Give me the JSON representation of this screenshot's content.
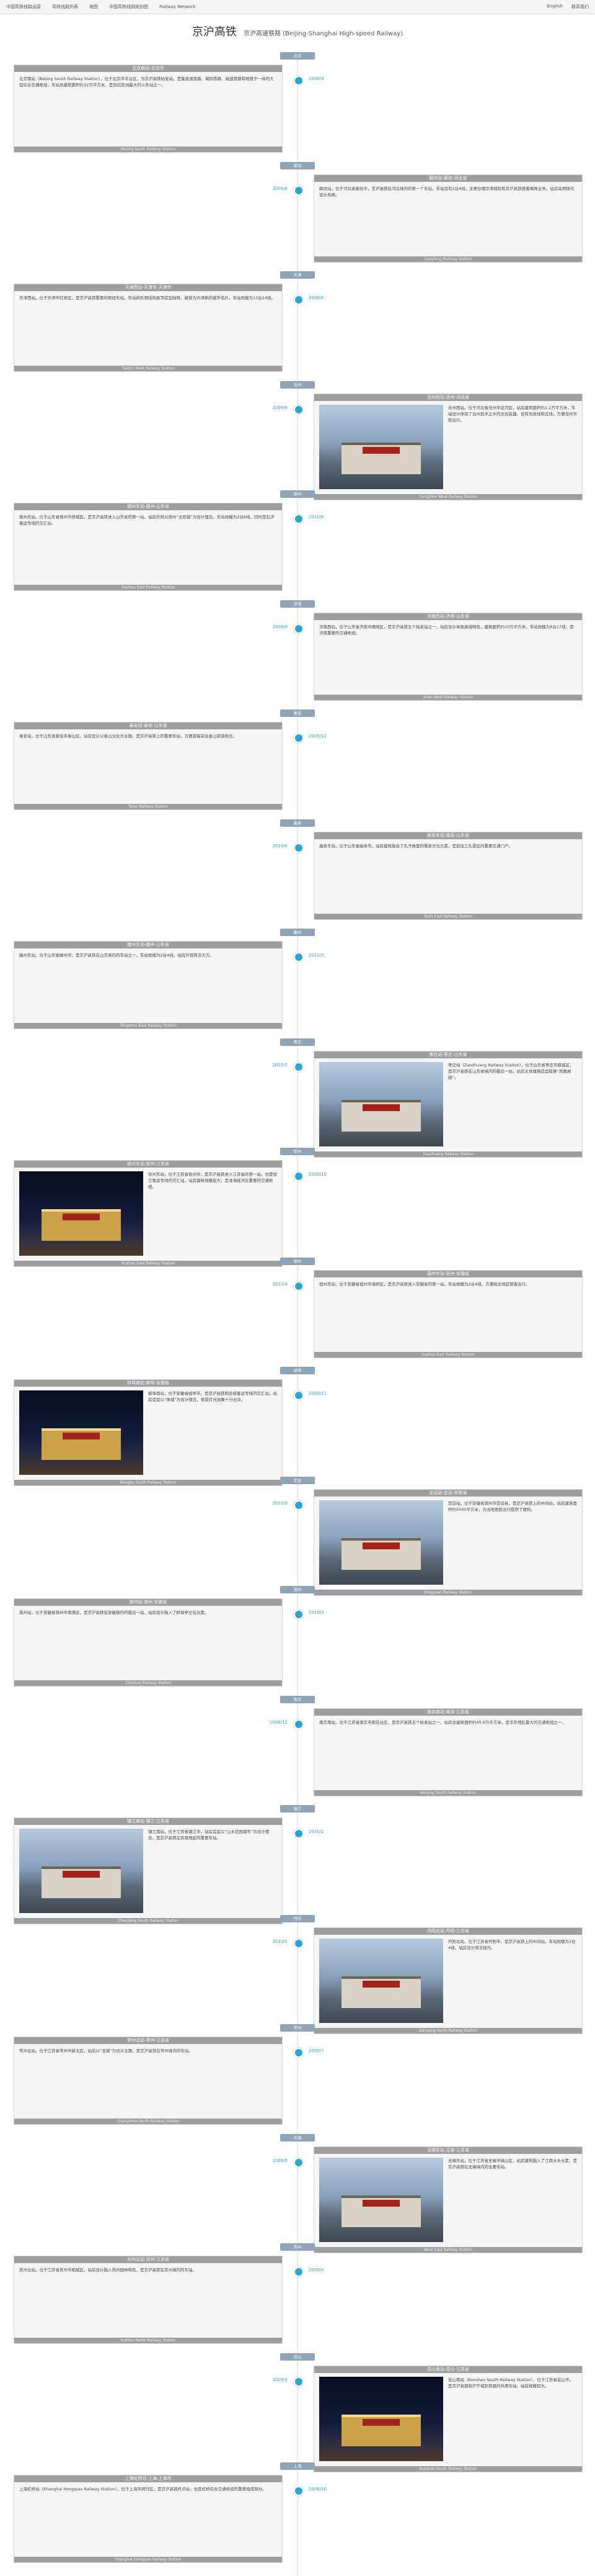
{
  "nav": {
    "brand": "中国高铁线路运营",
    "links": [
      "高铁线路列表",
      "地图",
      "中国高铁线网规划图",
      "Railway Network"
    ],
    "right": [
      "English",
      "联系我们"
    ]
  },
  "page": {
    "title": "京沪高铁",
    "subtitle": "京沪高速铁路 (Beijing-Shanghai High-speed Railway)"
  },
  "stations": [
    {
      "tag": "北京",
      "date": "2008/4",
      "title": "北京南站-北京市",
      "caption": "Beijing South Railway Station",
      "photo": false,
      "text": "北京南站（Beijing South Railway Station），位于北京市丰台区，为京沪高铁始发站，是集普速铁路、城际铁路、高速铁路和地铁于一体的大型综合交通枢纽，车站总建筑面积约32万平方米，是目前亚洲最大的火车站之一。"
    },
    {
      "tag": "廊坊",
      "date": "2009/6",
      "title": "廊坊站-廊坊-河北省",
      "caption": "Langfang Railway Station",
      "photo": false,
      "text": "廊坊站，位于河北省廊坊市，京沪高铁在河北境内的第一个车站，车站设有2台4线，主要办理京津城际和京沪高铁旅客乘降业务，站房采用现代设计风格。"
    },
    {
      "tag": "天津",
      "date": "2008/8",
      "title": "天津西站-天津市-天津市",
      "caption": "Tianjin West Railway Station",
      "photo": false,
      "text": "天津西站，位于天津市红桥区，是京沪高铁重要的枢纽车站，车站拱形钢结构屋顶造型独特，被誉为天津新的城市名片，车站规模为13台24线。"
    },
    {
      "tag": "沧州",
      "date": "2009/8",
      "title": "沧州西站-沧州-河北省",
      "caption": "Cangzhou West Railway Station",
      "photo": true,
      "night": false,
      "text": "沧州西站，位于河北省沧州市运河区，站房建筑面积约1.2万平方米，车站设计体现了沧州武术之乡的文化底蕴，设有到发线和正线，方便沧州市民出行。"
    },
    {
      "tag": "德州",
      "date": "2010/8",
      "title": "德州东站-德州-山东省",
      "caption": "Dezhou East Railway Station",
      "photo": false,
      "text": "德州东站，位于山东省德州市德城区，是京沪高铁进入山东省的第一站，站房外观以德州“太阳城”为设计理念，车站规模为2台6线，同时是石济客运专线的交汇站。"
    },
    {
      "tag": "济南",
      "date": "2009/9",
      "title": "济南西站-济南-山东省",
      "caption": "Jinan West Railway Station",
      "photo": false,
      "text": "济南西站，位于山东省济南市槐荫区，是京沪高铁五个始发站之一，站房设计体现泉城特色，建筑面积约10万平方米，车站规模为8台17线，是济南重要的交通枢纽。"
    },
    {
      "tag": "泰安",
      "date": "2009/12",
      "title": "泰安站-泰安-山东省",
      "caption": "Taian Railway Station",
      "photo": false,
      "text": "泰安站，位于山东省泰安市泰山区，站房设计以泰山文化为主题，是京沪高铁上的重要车站，方便游客前往泰山旅游观光。"
    },
    {
      "tag": "曲阜",
      "date": "2010/6",
      "title": "曲阜东站-曲阜-山东省",
      "caption": "Qufu East Railway Station",
      "photo": false,
      "text": "曲阜东站，位于山东省曲阜市，站房建筑融合了孔子故里的儒家文化元素，是前往三孔景区的重要交通门户。"
    },
    {
      "tag": "滕州",
      "date": "2010/5",
      "title": "滕州东站-滕州-山东省",
      "caption": "Tengzhou East Railway Station",
      "photo": false,
      "text": "滕州东站，位于山东省滕州市，是京沪高铁在山东境内的车站之一，车站规模为2台4线，站房外观简洁大方。"
    },
    {
      "tag": "枣庄",
      "date": "2010/7",
      "title": "枣庄站-枣庄-山东省",
      "caption": "Zaozhuang Railway Station",
      "photo": true,
      "night": false,
      "text": "枣庄站（Zaozhuang Railway Station），位于山东省枣庄市薛城区，是京沪高铁在山东省境内的最后一站，站房主体建筑造型取意“凤凰展翅”。"
    },
    {
      "tag": "徐州",
      "date": "2009/10",
      "title": "徐州东站-徐州-江苏省",
      "caption": "Xuzhou East Railway Station",
      "photo": true,
      "night": true,
      "text": "徐州东站，位于江苏省徐州市，是京沪高铁进入江苏省的第一站，也是徐兰客运专线的交汇站，站房建筑规模宏大，是淮海经济区重要的交通枢纽。"
    },
    {
      "tag": "宿州",
      "date": "2010/4",
      "title": "宿州东站-宿州-安徽省",
      "caption": "Suzhou East Railway Station",
      "photo": false,
      "text": "宿州东站，位于安徽省宿州市埇桥区，是京沪高铁进入安徽省的第一站，车站规模为2台4线，方便皖北地区旅客出行。"
    },
    {
      "tag": "蚌埠",
      "date": "2009/11",
      "title": "蚌埠南站-蚌埠-安徽省",
      "caption": "Bengbu South Railway Station",
      "photo": true,
      "night": true,
      "text": "蚌埠南站，位于安徽省蚌埠市，是京沪高铁和合蚌客运专线的交汇站，站房造型以“珠城”为设计理念，夜景灯光效果十分出众。"
    },
    {
      "tag": "定远",
      "date": "2010/9",
      "title": "定远站-定远-安徽省",
      "caption": "Dingyuan Railway Station",
      "photo": true,
      "night": false,
      "text": "定远站，位于安徽省滁州市定远县，是京沪高铁上的中间站，站房建筑面积约5000平方米，为当地居民出行提供了便利。"
    },
    {
      "tag": "滁州",
      "date": "2010/3",
      "title": "滁州站-滁州-安徽省",
      "caption": "Chuzhou Railway Station",
      "photo": false,
      "text": "滁州站，位于安徽省滁州市南谯区，是京沪高铁在安徽境内的最后一站，站房设计融入了醉翁亭文化元素。"
    },
    {
      "tag": "南京",
      "date": "2008/12",
      "title": "南京南站-南京-江苏省",
      "caption": "Nanjing South Railway Station",
      "photo": false,
      "text": "南京南站，位于江苏省南京市雨花台区，是京沪高铁五个始发站之一，站房总建筑面积约45.8万平方米，是华东地区最大的交通枢纽之一。"
    },
    {
      "tag": "镇江",
      "date": "2010/2",
      "title": "镇江南站-镇江-江苏省",
      "caption": "Zhenjiang South Railway Station",
      "photo": true,
      "night": false,
      "text": "镇江南站，位于江苏省镇江市，站房造型以“山水花园城市”为设计理念，是京沪高铁在苏南地区的重要车站。"
    },
    {
      "tag": "丹阳",
      "date": "2010/1",
      "title": "丹阳北站-丹阳-江苏省",
      "caption": "Danyang North Railway Station",
      "photo": true,
      "night": false,
      "text": "丹阳北站，位于江苏省丹阳市，是京沪高铁上的中间站，车站规模为2台4线，站房设计简洁现代。"
    },
    {
      "tag": "常州",
      "date": "2009/7",
      "title": "常州北站-常州-江苏省",
      "caption": "Changzhou North Railway Station",
      "photo": false,
      "text": "常州北站，位于江苏省常州市新北区，站房以“龙城”为设计主题，是京沪高铁在常州境内的车站。"
    },
    {
      "tag": "无锡",
      "date": "2009/5",
      "title": "无锡东站-无锡-江苏省",
      "caption": "Wuxi East Railway Station",
      "photo": true,
      "night": false,
      "text": "无锡东站，位于江苏省无锡市锡山区，站房建筑融入了江南水乡元素，是京沪高铁在无锡境内的主要车站。"
    },
    {
      "tag": "苏州",
      "date": "2009/4",
      "title": "苏州北站-苏州-江苏省",
      "caption": "Suzhou North Railway Station",
      "photo": false,
      "text": "苏州北站，位于江苏省苏州市相城区，站房设计融入苏州园林特色，是京沪高铁在苏州境内的车站。"
    },
    {
      "tag": "昆山",
      "date": "2009/3",
      "title": "昆山南站-昆山-江苏省",
      "caption": "Kunshan South Railway Station",
      "photo": true,
      "night": true,
      "text": "昆山南站（Kunshan South Railway Station），位于江苏省昆山市，是京沪高铁和沪宁城际铁路的共用车站，站房规模较大。"
    },
    {
      "tag": "上海",
      "date": "2008/10",
      "title": "上海虹桥站-上海-上海市",
      "caption": "Shanghai Hongqiao Railway Station",
      "photo": false,
      "text": "上海虹桥站（Shanghai Hongqiao Railway Station），位于上海市闵行区，是京沪高铁终点站，也是虹桥综合交通枢纽的重要组成部分。"
    }
  ]
}
